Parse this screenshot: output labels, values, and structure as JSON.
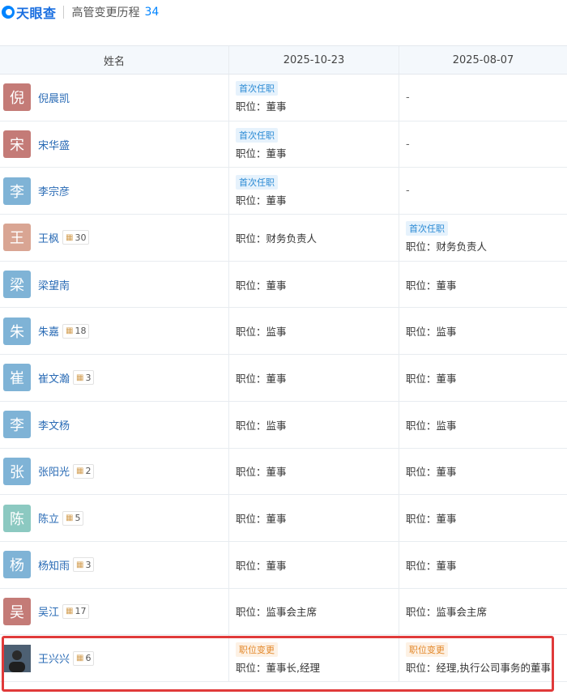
{
  "header": {
    "logo_text": "天眼查",
    "title": "高管变更历程",
    "count": "34"
  },
  "table": {
    "columns": [
      "姓名",
      "2025-10-23",
      "2025-08-07"
    ],
    "rows": [
      {
        "avatar_char": "倪",
        "avatar_color": "#c47b77",
        "name": "倪晨凯",
        "badge": null,
        "d1": {
          "tag": "首次任职",
          "tag_type": "blue",
          "position": "职位：董事"
        },
        "d2": {
          "dash": "-"
        }
      },
      {
        "avatar_char": "宋",
        "avatar_color": "#c47b77",
        "name": "宋华盛",
        "badge": null,
        "d1": {
          "tag": "首次任职",
          "tag_type": "blue",
          "position": "职位：董事"
        },
        "d2": {
          "dash": "-"
        }
      },
      {
        "avatar_char": "李",
        "avatar_color": "#7fb3d6",
        "name": "李宗彦",
        "badge": null,
        "d1": {
          "tag": "首次任职",
          "tag_type": "blue",
          "position": "职位：董事"
        },
        "d2": {
          "dash": "-"
        }
      },
      {
        "avatar_char": "王",
        "avatar_color": "#d9a593",
        "name": "王枫",
        "badge": "30",
        "d1": {
          "position": "职位：财务负责人"
        },
        "d2": {
          "tag": "首次任职",
          "tag_type": "blue",
          "position": "职位：财务负责人"
        }
      },
      {
        "avatar_char": "梁",
        "avatar_color": "#7fb3d6",
        "name": "梁望南",
        "badge": null,
        "d1": {
          "position": "职位：董事"
        },
        "d2": {
          "position": "职位：董事"
        }
      },
      {
        "avatar_char": "朱",
        "avatar_color": "#7fb3d6",
        "name": "朱嘉",
        "badge": "18",
        "d1": {
          "position": "职位：监事"
        },
        "d2": {
          "position": "职位：监事"
        }
      },
      {
        "avatar_char": "崔",
        "avatar_color": "#7fb3d6",
        "name": "崔文瀚",
        "badge": "3",
        "d1": {
          "position": "职位：董事"
        },
        "d2": {
          "position": "职位：董事"
        }
      },
      {
        "avatar_char": "李",
        "avatar_color": "#7fb3d6",
        "name": "李文杨",
        "badge": null,
        "d1": {
          "position": "职位：监事"
        },
        "d2": {
          "position": "职位：监事"
        }
      },
      {
        "avatar_char": "张",
        "avatar_color": "#7fb3d6",
        "name": "张阳光",
        "badge": "2",
        "d1": {
          "position": "职位：董事"
        },
        "d2": {
          "position": "职位：董事"
        }
      },
      {
        "avatar_char": "陈",
        "avatar_color": "#8cc9c1",
        "name": "陈立",
        "badge": "5",
        "d1": {
          "position": "职位：董事"
        },
        "d2": {
          "position": "职位：董事"
        }
      },
      {
        "avatar_char": "杨",
        "avatar_color": "#7fb3d6",
        "name": "杨知雨",
        "badge": "3",
        "d1": {
          "position": "职位：董事"
        },
        "d2": {
          "position": "职位：董事"
        }
      },
      {
        "avatar_char": "吴",
        "avatar_color": "#c47b77",
        "name": "吴江",
        "badge": "17",
        "d1": {
          "position": "职位：监事会主席"
        },
        "d2": {
          "position": "职位：监事会主席"
        }
      },
      {
        "avatar_char": "",
        "avatar_color": "#5a6f84",
        "avatar_photo": true,
        "name": "王兴兴",
        "badge": "6",
        "d1": {
          "tag": "职位变更",
          "tag_type": "orange",
          "position": "职位：董事长,经理"
        },
        "d2": {
          "tag": "职位变更",
          "tag_type": "orange",
          "position": "职位：经理,执行公司事务的董事"
        }
      }
    ]
  },
  "colors": {
    "accent": "#0084ff",
    "highlight": "#e03a3a"
  }
}
